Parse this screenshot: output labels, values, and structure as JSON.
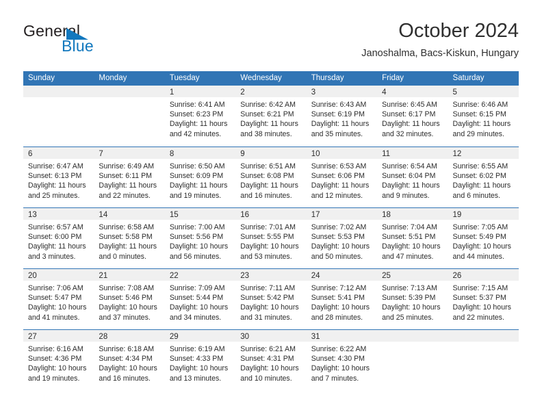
{
  "brand": {
    "name_part1": "General",
    "name_part2": "Blue",
    "primary_color": "#1278be",
    "triangle_icon": "triangle-icon"
  },
  "header": {
    "title": "October 2024",
    "subtitle": "Janoshalma, Bacs-Kiskun, Hungary"
  },
  "calendar": {
    "header_bg": "#3175b5",
    "daynum_bg": "#f0f0f0",
    "day_names": [
      "Sunday",
      "Monday",
      "Tuesday",
      "Wednesday",
      "Thursday",
      "Friday",
      "Saturday"
    ],
    "weeks": [
      [
        {
          "empty": true
        },
        {
          "empty": true
        },
        {
          "day": "1",
          "sunrise": "Sunrise: 6:41 AM",
          "sunset": "Sunset: 6:23 PM",
          "daylight_1": "Daylight: 11 hours",
          "daylight_2": "and 42 minutes."
        },
        {
          "day": "2",
          "sunrise": "Sunrise: 6:42 AM",
          "sunset": "Sunset: 6:21 PM",
          "daylight_1": "Daylight: 11 hours",
          "daylight_2": "and 38 minutes."
        },
        {
          "day": "3",
          "sunrise": "Sunrise: 6:43 AM",
          "sunset": "Sunset: 6:19 PM",
          "daylight_1": "Daylight: 11 hours",
          "daylight_2": "and 35 minutes."
        },
        {
          "day": "4",
          "sunrise": "Sunrise: 6:45 AM",
          "sunset": "Sunset: 6:17 PM",
          "daylight_1": "Daylight: 11 hours",
          "daylight_2": "and 32 minutes."
        },
        {
          "day": "5",
          "sunrise": "Sunrise: 6:46 AM",
          "sunset": "Sunset: 6:15 PM",
          "daylight_1": "Daylight: 11 hours",
          "daylight_2": "and 29 minutes."
        }
      ],
      [
        {
          "day": "6",
          "sunrise": "Sunrise: 6:47 AM",
          "sunset": "Sunset: 6:13 PM",
          "daylight_1": "Daylight: 11 hours",
          "daylight_2": "and 25 minutes."
        },
        {
          "day": "7",
          "sunrise": "Sunrise: 6:49 AM",
          "sunset": "Sunset: 6:11 PM",
          "daylight_1": "Daylight: 11 hours",
          "daylight_2": "and 22 minutes."
        },
        {
          "day": "8",
          "sunrise": "Sunrise: 6:50 AM",
          "sunset": "Sunset: 6:09 PM",
          "daylight_1": "Daylight: 11 hours",
          "daylight_2": "and 19 minutes."
        },
        {
          "day": "9",
          "sunrise": "Sunrise: 6:51 AM",
          "sunset": "Sunset: 6:08 PM",
          "daylight_1": "Daylight: 11 hours",
          "daylight_2": "and 16 minutes."
        },
        {
          "day": "10",
          "sunrise": "Sunrise: 6:53 AM",
          "sunset": "Sunset: 6:06 PM",
          "daylight_1": "Daylight: 11 hours",
          "daylight_2": "and 12 minutes."
        },
        {
          "day": "11",
          "sunrise": "Sunrise: 6:54 AM",
          "sunset": "Sunset: 6:04 PM",
          "daylight_1": "Daylight: 11 hours",
          "daylight_2": "and 9 minutes."
        },
        {
          "day": "12",
          "sunrise": "Sunrise: 6:55 AM",
          "sunset": "Sunset: 6:02 PM",
          "daylight_1": "Daylight: 11 hours",
          "daylight_2": "and 6 minutes."
        }
      ],
      [
        {
          "day": "13",
          "sunrise": "Sunrise: 6:57 AM",
          "sunset": "Sunset: 6:00 PM",
          "daylight_1": "Daylight: 11 hours",
          "daylight_2": "and 3 minutes."
        },
        {
          "day": "14",
          "sunrise": "Sunrise: 6:58 AM",
          "sunset": "Sunset: 5:58 PM",
          "daylight_1": "Daylight: 11 hours",
          "daylight_2": "and 0 minutes."
        },
        {
          "day": "15",
          "sunrise": "Sunrise: 7:00 AM",
          "sunset": "Sunset: 5:56 PM",
          "daylight_1": "Daylight: 10 hours",
          "daylight_2": "and 56 minutes."
        },
        {
          "day": "16",
          "sunrise": "Sunrise: 7:01 AM",
          "sunset": "Sunset: 5:55 PM",
          "daylight_1": "Daylight: 10 hours",
          "daylight_2": "and 53 minutes."
        },
        {
          "day": "17",
          "sunrise": "Sunrise: 7:02 AM",
          "sunset": "Sunset: 5:53 PM",
          "daylight_1": "Daylight: 10 hours",
          "daylight_2": "and 50 minutes."
        },
        {
          "day": "18",
          "sunrise": "Sunrise: 7:04 AM",
          "sunset": "Sunset: 5:51 PM",
          "daylight_1": "Daylight: 10 hours",
          "daylight_2": "and 47 minutes."
        },
        {
          "day": "19",
          "sunrise": "Sunrise: 7:05 AM",
          "sunset": "Sunset: 5:49 PM",
          "daylight_1": "Daylight: 10 hours",
          "daylight_2": "and 44 minutes."
        }
      ],
      [
        {
          "day": "20",
          "sunrise": "Sunrise: 7:06 AM",
          "sunset": "Sunset: 5:47 PM",
          "daylight_1": "Daylight: 10 hours",
          "daylight_2": "and 41 minutes."
        },
        {
          "day": "21",
          "sunrise": "Sunrise: 7:08 AM",
          "sunset": "Sunset: 5:46 PM",
          "daylight_1": "Daylight: 10 hours",
          "daylight_2": "and 37 minutes."
        },
        {
          "day": "22",
          "sunrise": "Sunrise: 7:09 AM",
          "sunset": "Sunset: 5:44 PM",
          "daylight_1": "Daylight: 10 hours",
          "daylight_2": "and 34 minutes."
        },
        {
          "day": "23",
          "sunrise": "Sunrise: 7:11 AM",
          "sunset": "Sunset: 5:42 PM",
          "daylight_1": "Daylight: 10 hours",
          "daylight_2": "and 31 minutes."
        },
        {
          "day": "24",
          "sunrise": "Sunrise: 7:12 AM",
          "sunset": "Sunset: 5:41 PM",
          "daylight_1": "Daylight: 10 hours",
          "daylight_2": "and 28 minutes."
        },
        {
          "day": "25",
          "sunrise": "Sunrise: 7:13 AM",
          "sunset": "Sunset: 5:39 PM",
          "daylight_1": "Daylight: 10 hours",
          "daylight_2": "and 25 minutes."
        },
        {
          "day": "26",
          "sunrise": "Sunrise: 7:15 AM",
          "sunset": "Sunset: 5:37 PM",
          "daylight_1": "Daylight: 10 hours",
          "daylight_2": "and 22 minutes."
        }
      ],
      [
        {
          "day": "27",
          "sunrise": "Sunrise: 6:16 AM",
          "sunset": "Sunset: 4:36 PM",
          "daylight_1": "Daylight: 10 hours",
          "daylight_2": "and 19 minutes."
        },
        {
          "day": "28",
          "sunrise": "Sunrise: 6:18 AM",
          "sunset": "Sunset: 4:34 PM",
          "daylight_1": "Daylight: 10 hours",
          "daylight_2": "and 16 minutes."
        },
        {
          "day": "29",
          "sunrise": "Sunrise: 6:19 AM",
          "sunset": "Sunset: 4:33 PM",
          "daylight_1": "Daylight: 10 hours",
          "daylight_2": "and 13 minutes."
        },
        {
          "day": "30",
          "sunrise": "Sunrise: 6:21 AM",
          "sunset": "Sunset: 4:31 PM",
          "daylight_1": "Daylight: 10 hours",
          "daylight_2": "and 10 minutes."
        },
        {
          "day": "31",
          "sunrise": "Sunrise: 6:22 AM",
          "sunset": "Sunset: 4:30 PM",
          "daylight_1": "Daylight: 10 hours",
          "daylight_2": "and 7 minutes."
        },
        {
          "empty": true
        },
        {
          "empty": true
        }
      ]
    ]
  }
}
